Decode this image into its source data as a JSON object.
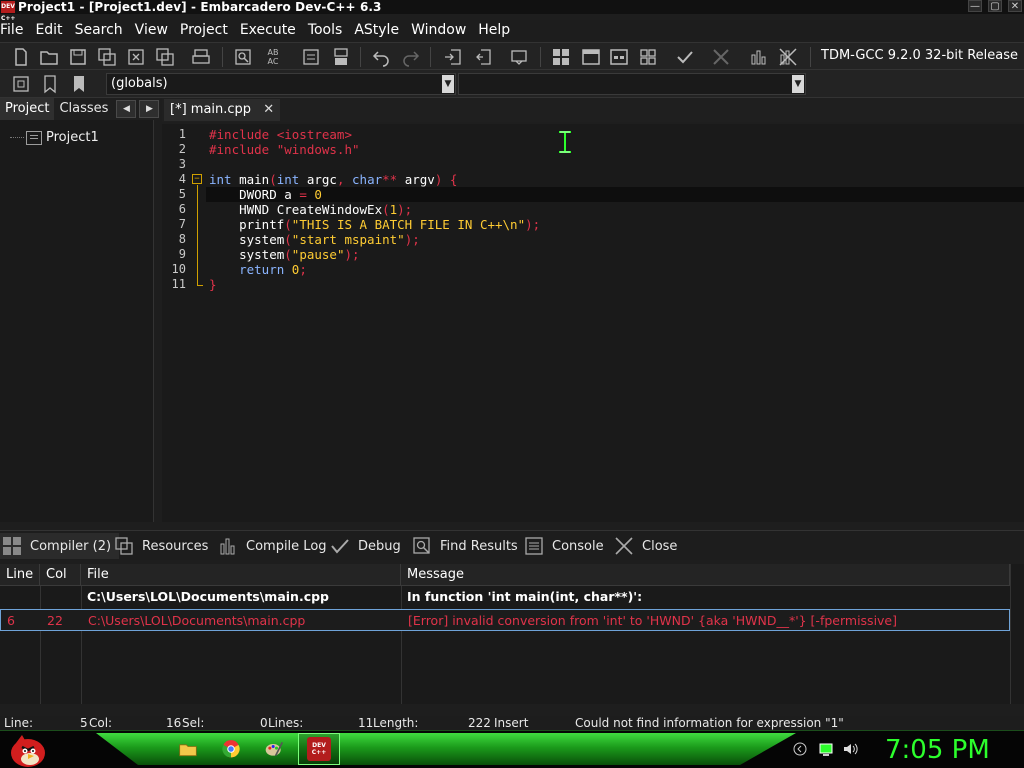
{
  "window": {
    "title": "Project1 - [Project1.dev] - Embarcadero Dev-C++ 6.3",
    "icon_text": "DEV C++",
    "controls": [
      "—",
      "▢",
      "✕"
    ]
  },
  "menu": [
    "File",
    "Edit",
    "Search",
    "View",
    "Project",
    "Execute",
    "Tools",
    "AStyle",
    "Window",
    "Help"
  ],
  "toolbar": {
    "compiler": "TDM-GCC 9.2.0 32-bit Release",
    "scope_combo": "(globals)",
    "scope_combo2": ""
  },
  "left_panel": {
    "tabs": [
      "Project",
      "Classes"
    ],
    "tree": [
      "Project1"
    ]
  },
  "editor": {
    "tab_label": "[*] main.cpp",
    "tab_close": "✕",
    "line_numbers": [
      "1",
      "2",
      "3",
      "4",
      "5",
      "6",
      "7",
      "8",
      "9",
      "10",
      "11"
    ]
  },
  "bottom_tabs": [
    "Compiler (2)",
    "Resources",
    "Compile Log",
    "Debug",
    "Find Results",
    "Console",
    "Close"
  ],
  "messages": {
    "columns": [
      "Line",
      "Col",
      "File",
      "Message"
    ],
    "rows": [
      {
        "line": "",
        "col": "",
        "file": "C:\\Users\\LOL\\Documents\\main.cpp",
        "message": "In function 'int main(int, char**)':"
      },
      {
        "line": "6",
        "col": "22",
        "file": "C:\\Users\\LOL\\Documents\\main.cpp",
        "message": "[Error] invalid conversion from 'int' to 'HWND' {aka 'HWND__*'} [-fpermissive]"
      }
    ]
  },
  "status": {
    "line": "Line:",
    "line_val": "5",
    "col": "Col:",
    "col_val": "16",
    "sel": "Sel:",
    "sel_val": "0",
    "lines": "Lines:",
    "lines_val": "11",
    "length": "Length:",
    "length_val": "222",
    "mode": "Insert",
    "info": "Could not find information for expression \"1\""
  },
  "taskbar": {
    "clock": "7:05 PM"
  },
  "colors": {
    "keyword": "#8ab4ff",
    "preprocessor": "#e0334a",
    "string": "#ffcc33",
    "error": "#e0334a",
    "taskbar_green": "#2cff2c"
  }
}
